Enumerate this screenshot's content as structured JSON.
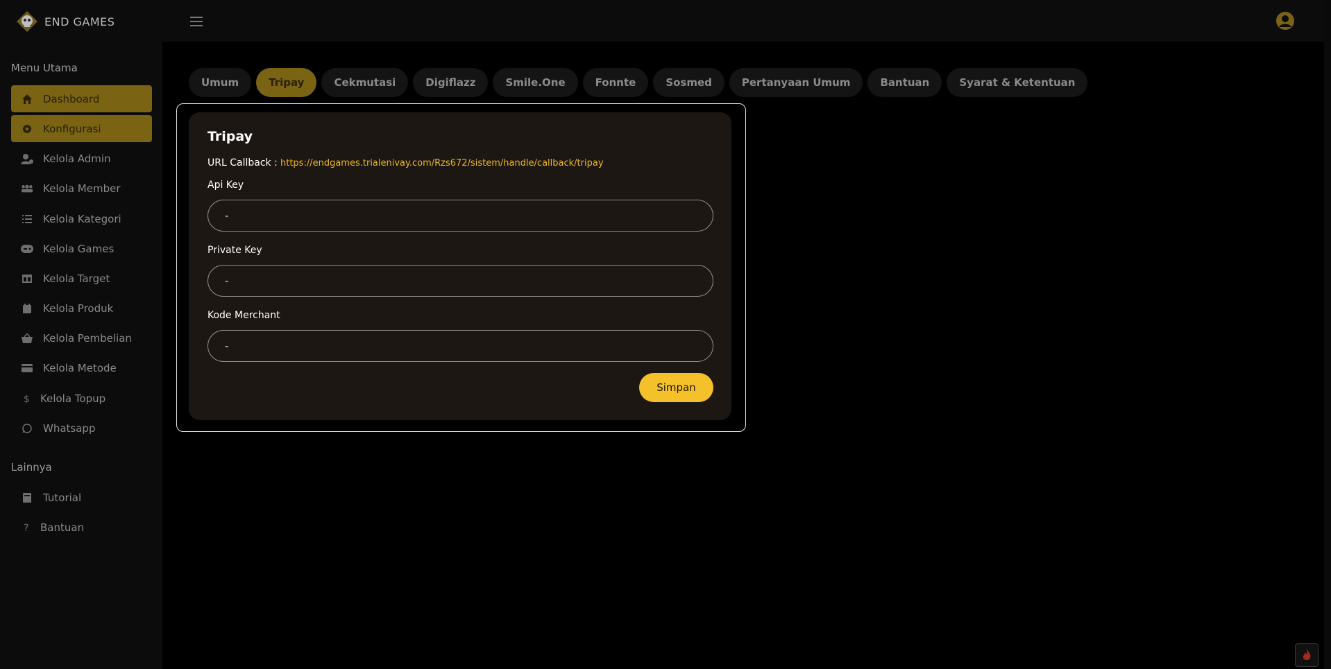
{
  "brand": {
    "name": "END GAMES",
    "logo_icon": "skull-logo-icon"
  },
  "header": {
    "menu_icon": "hamburger-icon",
    "user_icon": "user-circle-icon"
  },
  "sidebar": {
    "main_title": "Menu Utama",
    "items": [
      {
        "label": "Dashboard",
        "icon": "home-icon",
        "active": true
      },
      {
        "label": "Konfigurasi",
        "icon": "gear-icon",
        "active": true
      },
      {
        "label": "Kelola Admin",
        "icon": "user-cog-icon"
      },
      {
        "label": "Kelola Member",
        "icon": "users-icon"
      },
      {
        "label": "Kelola Kategori",
        "icon": "list-icon"
      },
      {
        "label": "Kelola Games",
        "icon": "gamepad-icon"
      },
      {
        "label": "Kelola Target",
        "icon": "table-icon"
      },
      {
        "label": "Kelola Produk",
        "icon": "calendar-icon"
      },
      {
        "label": "Kelola Pembelian",
        "icon": "basket-icon"
      },
      {
        "label": "Kelola Metode",
        "icon": "credit-card-icon"
      },
      {
        "label": "Kelola Topup",
        "icon": "dollar-icon"
      },
      {
        "label": "Whatsapp",
        "icon": "whatsapp-icon"
      }
    ],
    "other_title": "Lainnya",
    "other_items": [
      {
        "label": "Tutorial",
        "icon": "book-icon"
      },
      {
        "label": "Bantuan",
        "icon": "question-icon"
      }
    ]
  },
  "tabs": [
    {
      "label": "Umum"
    },
    {
      "label": "Tripay",
      "active": true
    },
    {
      "label": "Cekmutasi"
    },
    {
      "label": "Digiflazz"
    },
    {
      "label": "Smile.One"
    },
    {
      "label": "Fonnte"
    },
    {
      "label": "Sosmed"
    },
    {
      "label": "Pertanyaan Umum"
    },
    {
      "label": "Bantuan"
    },
    {
      "label": "Syarat & Ketentuan"
    }
  ],
  "form": {
    "title": "Tripay",
    "callback_label": "URL Callback :",
    "callback_url": "https://endgames.trialenivay.com/Rzs672/sistem/handle/callback/tripay",
    "api_key_label": "Api Key",
    "api_key_value": "-",
    "private_key_label": "Private Key",
    "private_key_value": "-",
    "merchant_label": "Kode Merchant",
    "merchant_value": "-",
    "save_label": "Simpan"
  },
  "colors": {
    "accent": "#f5c12a",
    "active_bg": "#7a6414",
    "card_bg": "#1c1713",
    "link": "#f0b81b"
  }
}
